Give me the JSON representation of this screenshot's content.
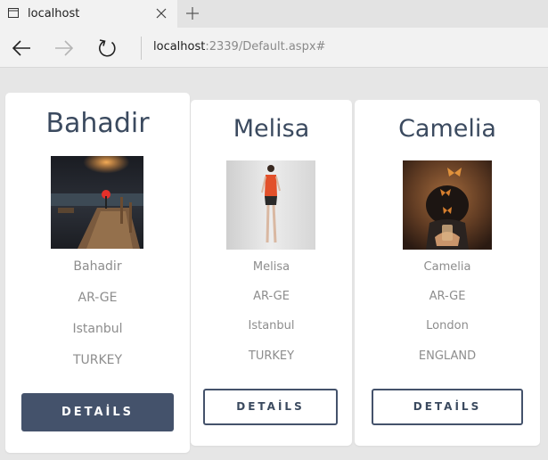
{
  "browser": {
    "tab_title": "localhost",
    "address_host": "localhost",
    "address_rest": ":2339/Default.aspx#"
  },
  "cards": [
    {
      "name": "Bahadir",
      "username": "Bahadir",
      "department": "AR-GE",
      "city": "Istanbul",
      "country": "TURKEY",
      "button_label": "DETAİLS",
      "button_style": "filled"
    },
    {
      "name": "Melisa",
      "username": "Melisa",
      "department": "AR-GE",
      "city": "Istanbul",
      "country": "TURKEY",
      "button_label": "DETAİLS",
      "button_style": "outline"
    },
    {
      "name": "Camelia",
      "username": "Camelia",
      "department": "AR-GE",
      "city": "London",
      "country": "ENGLAND",
      "button_label": "DETAİLS",
      "button_style": "outline"
    }
  ],
  "colors": {
    "accent": "#44526b",
    "heading": "#3b4a5f",
    "muted_text": "#8d8d8d",
    "page_bg": "#e6e6e6"
  },
  "icons": {
    "tab": "browser-tab-icon",
    "close": "close-icon",
    "new_tab": "plus-icon",
    "back": "back-arrow-icon",
    "forward": "forward-arrow-icon",
    "refresh": "refresh-icon"
  }
}
